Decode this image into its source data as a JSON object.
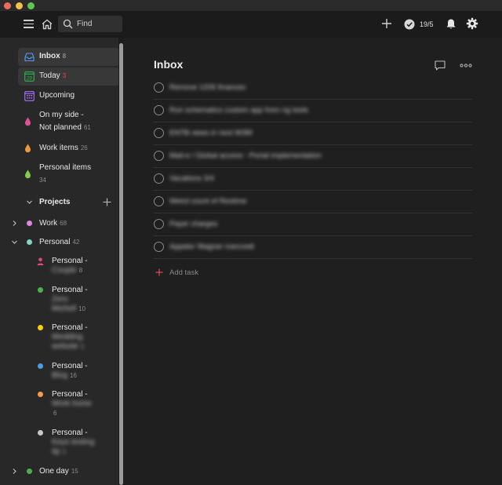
{
  "window": {
    "controls": [
      "close",
      "minimize",
      "zoom"
    ]
  },
  "topbar": {
    "search_placeholder": "Find",
    "karma_label": "19/5",
    "icons": [
      "menu-icon",
      "home-icon",
      "search-icon",
      "plus-icon",
      "karma-check-icon",
      "bell-icon",
      "gear-icon"
    ]
  },
  "sidebar": {
    "filters": [
      {
        "label": "Inbox",
        "count": "8",
        "icon": "inbox-icon",
        "color": "#5297ff",
        "active": true
      },
      {
        "label": "Today",
        "count": "3",
        "icon": "calendar-today-icon",
        "color": "#25b84c",
        "day": "29",
        "active": true
      },
      {
        "label": "Upcoming",
        "count": "",
        "icon": "calendar-upcoming-icon",
        "color": "#a970ff"
      },
      {
        "label_line1": "On my side -",
        "label_line2": "Not planned",
        "count": "61",
        "icon": "drop-icon",
        "color": "#e05194"
      },
      {
        "label": "Work items",
        "count": "26",
        "icon": "drop-icon",
        "color": "#f0943f"
      },
      {
        "label": "Personal items",
        "count": "34",
        "icon": "drop-icon",
        "color": "#7ecc49"
      }
    ],
    "projects_header": "Projects",
    "projects": [
      {
        "name": "Work",
        "count": "68",
        "color": "#d989e0",
        "collapsed": true
      },
      {
        "name": "Personal",
        "count": "42",
        "color": "#7ed8c5",
        "expanded": true
      },
      {
        "name_line1": "Personal -",
        "name_line2": "Couple",
        "count": "8",
        "color": "#e04b73",
        "icon": "person-icon"
      },
      {
        "name_line1": "Personal -",
        "name_line2": "Zero",
        "name_line3": "Michell",
        "count": "10",
        "color": "#4caf50"
      },
      {
        "name_line1": "Personal -",
        "name_line2": "Wedding",
        "name_line3": "website",
        "count": "1",
        "color": "#fad000"
      },
      {
        "name_line1": "Personal -",
        "name_line2": "Blog",
        "count": "16",
        "color": "#4a9ee8"
      },
      {
        "name_line1": "Personal -",
        "name_line2": "Work home",
        "count": "6",
        "color": "#f59a4b"
      },
      {
        "name_line1": "Personal -",
        "name_line2": "Keys testing",
        "name_line3": "tip",
        "count": "1",
        "color": "#c8c8c8"
      },
      {
        "name": "One day",
        "count": "15",
        "color": "#4caf50",
        "collapsed": true
      }
    ]
  },
  "main": {
    "title": "Inbox",
    "tasks": [
      "Remove 1205 finances",
      "Run schematics custom app from ng tools",
      "ENTB news in next W3M",
      "Mail-e / Global access - Portal implementation",
      "Vacations 3/4",
      "Weird count of Restime",
      "Payer charges",
      "Appeler Wagner mercredi"
    ],
    "add_task_label": "Add task",
    "accent": "#de4c4a"
  }
}
